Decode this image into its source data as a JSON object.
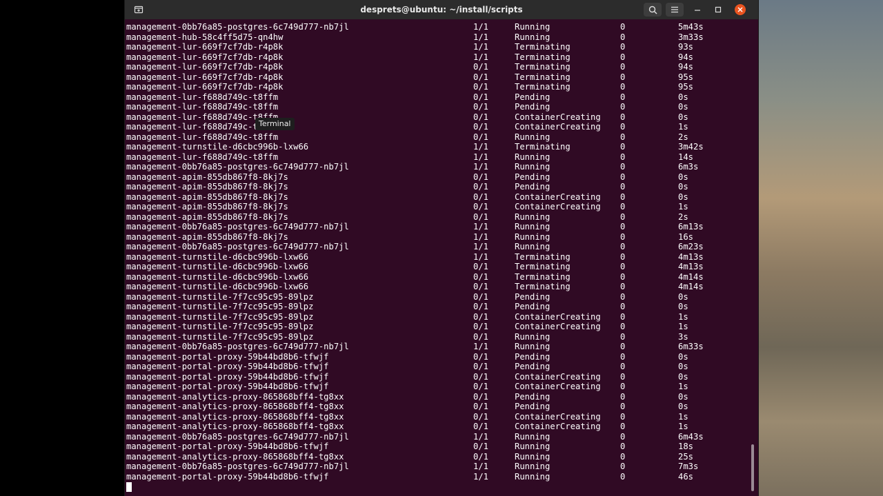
{
  "window": {
    "title": "desprets@ubuntu: ~/install/scripts",
    "tooltip": "Terminal",
    "background": "#300a24",
    "accent_close": "#e95420"
  },
  "icons": {
    "new_tab": "new-tab-icon",
    "search": "search-icon",
    "menu": "hamburger-menu-icon",
    "minimize": "minimize-icon",
    "maximize": "maximize-icon",
    "close": "close-icon"
  },
  "rows": [
    [
      "management-0bb76a85-postgres-6c749d777-nb7jl",
      "1/1",
      "Running",
      "0",
      "5m43s"
    ],
    [
      "management-hub-58c4ff5d75-qn4hw",
      "1/1",
      "Running",
      "0",
      "3m33s"
    ],
    [
      "management-lur-669f7cf7db-r4p8k",
      "1/1",
      "Terminating",
      "0",
      "93s"
    ],
    [
      "management-lur-669f7cf7db-r4p8k",
      "1/1",
      "Terminating",
      "0",
      "94s"
    ],
    [
      "management-lur-669f7cf7db-r4p8k",
      "0/1",
      "Terminating",
      "0",
      "94s"
    ],
    [
      "management-lur-669f7cf7db-r4p8k",
      "0/1",
      "Terminating",
      "0",
      "95s"
    ],
    [
      "management-lur-669f7cf7db-r4p8k",
      "0/1",
      "Terminating",
      "0",
      "95s"
    ],
    [
      "management-lur-f688d749c-t8ffm",
      "0/1",
      "Pending",
      "0",
      "0s"
    ],
    [
      "management-lur-f688d749c-t8ffm",
      "0/1",
      "Pending",
      "0",
      "0s"
    ],
    [
      "management-lur-f688d749c-t8ffm",
      "0/1",
      "ContainerCreating",
      "0",
      "0s"
    ],
    [
      "management-lur-f688d749c-t8ffm",
      "0/1",
      "ContainerCreating",
      "0",
      "1s"
    ],
    [
      "management-lur-f688d749c-t8ffm",
      "0/1",
      "Running",
      "0",
      "2s"
    ],
    [
      "management-turnstile-d6cbc996b-lxw66",
      "1/1",
      "Terminating",
      "0",
      "3m42s"
    ],
    [
      "management-lur-f688d749c-t8ffm",
      "1/1",
      "Running",
      "0",
      "14s"
    ],
    [
      "management-0bb76a85-postgres-6c749d777-nb7jl",
      "1/1",
      "Running",
      "0",
      "6m3s"
    ],
    [
      "management-apim-855db867f8-8kj7s",
      "0/1",
      "Pending",
      "0",
      "0s"
    ],
    [
      "management-apim-855db867f8-8kj7s",
      "0/1",
      "Pending",
      "0",
      "0s"
    ],
    [
      "management-apim-855db867f8-8kj7s",
      "0/1",
      "ContainerCreating",
      "0",
      "0s"
    ],
    [
      "management-apim-855db867f8-8kj7s",
      "0/1",
      "ContainerCreating",
      "0",
      "1s"
    ],
    [
      "management-apim-855db867f8-8kj7s",
      "0/1",
      "Running",
      "0",
      "2s"
    ],
    [
      "management-0bb76a85-postgres-6c749d777-nb7jl",
      "1/1",
      "Running",
      "0",
      "6m13s"
    ],
    [
      "management-apim-855db867f8-8kj7s",
      "1/1",
      "Running",
      "0",
      "16s"
    ],
    [
      "management-0bb76a85-postgres-6c749d777-nb7jl",
      "1/1",
      "Running",
      "0",
      "6m23s"
    ],
    [
      "management-turnstile-d6cbc996b-lxw66",
      "1/1",
      "Terminating",
      "0",
      "4m13s"
    ],
    [
      "management-turnstile-d6cbc996b-lxw66",
      "0/1",
      "Terminating",
      "0",
      "4m13s"
    ],
    [
      "management-turnstile-d6cbc996b-lxw66",
      "0/1",
      "Terminating",
      "0",
      "4m14s"
    ],
    [
      "management-turnstile-d6cbc996b-lxw66",
      "0/1",
      "Terminating",
      "0",
      "4m14s"
    ],
    [
      "management-turnstile-7f7cc95c95-89lpz",
      "0/1",
      "Pending",
      "0",
      "0s"
    ],
    [
      "management-turnstile-7f7cc95c95-89lpz",
      "0/1",
      "Pending",
      "0",
      "0s"
    ],
    [
      "management-turnstile-7f7cc95c95-89lpz",
      "0/1",
      "ContainerCreating",
      "0",
      "1s"
    ],
    [
      "management-turnstile-7f7cc95c95-89lpz",
      "0/1",
      "ContainerCreating",
      "0",
      "1s"
    ],
    [
      "management-turnstile-7f7cc95c95-89lpz",
      "0/1",
      "Running",
      "0",
      "3s"
    ],
    [
      "management-0bb76a85-postgres-6c749d777-nb7jl",
      "1/1",
      "Running",
      "0",
      "6m33s"
    ],
    [
      "management-portal-proxy-59b44bd8b6-tfwjf",
      "0/1",
      "Pending",
      "0",
      "0s"
    ],
    [
      "management-portal-proxy-59b44bd8b6-tfwjf",
      "0/1",
      "Pending",
      "0",
      "0s"
    ],
    [
      "management-portal-proxy-59b44bd8b6-tfwjf",
      "0/1",
      "ContainerCreating",
      "0",
      "0s"
    ],
    [
      "management-portal-proxy-59b44bd8b6-tfwjf",
      "0/1",
      "ContainerCreating",
      "0",
      "1s"
    ],
    [
      "management-analytics-proxy-865868bff4-tg8xx",
      "0/1",
      "Pending",
      "0",
      "0s"
    ],
    [
      "management-analytics-proxy-865868bff4-tg8xx",
      "0/1",
      "Pending",
      "0",
      "0s"
    ],
    [
      "management-analytics-proxy-865868bff4-tg8xx",
      "0/1",
      "ContainerCreating",
      "0",
      "1s"
    ],
    [
      "management-analytics-proxy-865868bff4-tg8xx",
      "0/1",
      "ContainerCreating",
      "0",
      "1s"
    ],
    [
      "management-0bb76a85-postgres-6c749d777-nb7jl",
      "1/1",
      "Running",
      "0",
      "6m43s"
    ],
    [
      "management-portal-proxy-59b44bd8b6-tfwjf",
      "0/1",
      "Running",
      "0",
      "18s"
    ],
    [
      "management-analytics-proxy-865868bff4-tg8xx",
      "0/1",
      "Running",
      "0",
      "25s"
    ],
    [
      "management-0bb76a85-postgres-6c749d777-nb7jl",
      "1/1",
      "Running",
      "0",
      "7m3s"
    ],
    [
      "management-portal-proxy-59b44bd8b6-tfwjf",
      "1/1",
      "Running",
      "0",
      "46s"
    ]
  ]
}
